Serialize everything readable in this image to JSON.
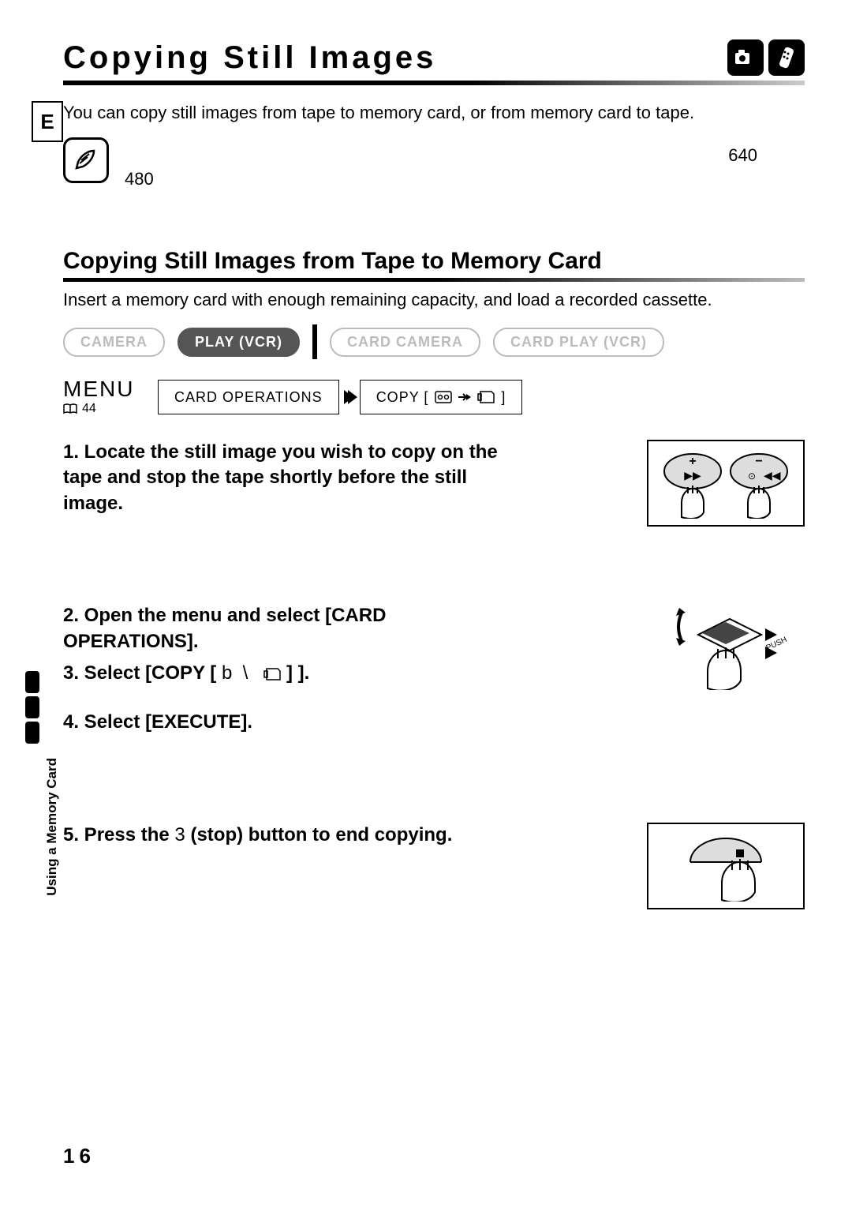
{
  "header": {
    "title": "Copying Still Images",
    "lang_tab": "E"
  },
  "intro": "You can copy still images from tape to memory card, or from memory card to tape.",
  "note": {
    "left_value": "480",
    "right_value": "640"
  },
  "section": {
    "title": "Copying Still Images from Tape to Memory Card",
    "text": "Insert a memory card with enough remaining capacity, and load a recorded cassette."
  },
  "modes": {
    "camera": "CAMERA",
    "play_vcr": "PLAY (VCR)",
    "card_camera": "CARD CAMERA",
    "card_play_vcr": "CARD PLAY (VCR)"
  },
  "menu": {
    "label": "MENU",
    "ref": "44",
    "box1": "CARD OPERATIONS",
    "box2_prefix": "COPY ["
  },
  "steps": {
    "s1": "1. Locate the still image you wish to copy on the tape and stop the tape shortly before the still image.",
    "s2": "2. Open the menu and select [CARD OPERATIONS].",
    "s3_prefix": "3. Select [COPY [",
    "s3_suffix": "] ].",
    "s4": "4. Select [EXECUTE].",
    "s5_prefix": "5. Press the ",
    "s5_stop": "3",
    "s5_suffix": " (stop) button to end copying."
  },
  "sidebar": {
    "label": "Using a Memory Card"
  },
  "page_number": "16"
}
